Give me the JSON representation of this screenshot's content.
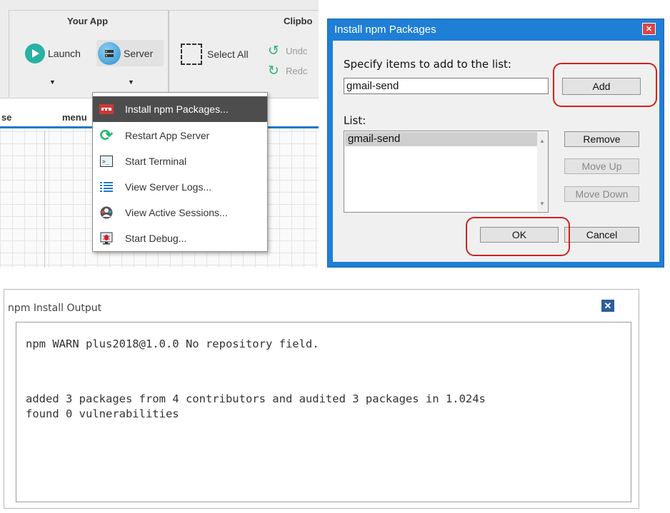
{
  "ribbon": {
    "group_your_app": "Your App",
    "launch_label": "Launch",
    "server_label": "Server",
    "group_clipboard": "Clipbo",
    "select_all_label": "Select All",
    "undo_label": "Undc",
    "redo_label": "Redc"
  },
  "tabs": {
    "left": "se",
    "menu": "menu"
  },
  "server_menu": {
    "items": [
      {
        "label": "Install npm Packages...",
        "icon": "npm-icon"
      },
      {
        "label": "Restart App Server",
        "icon": "refresh-icon"
      },
      {
        "label": "Start Terminal",
        "icon": "terminal-icon"
      },
      {
        "label": "View Server Logs...",
        "icon": "list-icon"
      },
      {
        "label": "View Active Sessions...",
        "icon": "sessions-icon"
      },
      {
        "label": "Start Debug...",
        "icon": "debug-icon"
      }
    ]
  },
  "npm_dialog": {
    "title": "Install npm Packages",
    "close_glyph": "✕",
    "specify_label": "Specify items to add to the list:",
    "input_value": "gmail-send",
    "add_button": "Add",
    "list_label": "List:",
    "list_items": [
      "gmail-send"
    ],
    "remove_button": "Remove",
    "move_up_button": "Move Up",
    "move_down_button": "Move Down",
    "ok_button": "OK",
    "cancel_button": "Cancel"
  },
  "output_window": {
    "title": "npm Install Output",
    "close_glyph": "✕",
    "lines": [
      "npm WARN plus2018@1.0.0 No repository field.",
      "added 3 packages from 4 contributors and audited 3 packages in 1.024s",
      "found 0 vulnerabilities"
    ]
  },
  "colors": {
    "accent_blue": "#1e7ac8",
    "dialog_frame": "#1f7fd6",
    "highlight_ring": "#d42020",
    "menu_active": "#4d4d4d"
  }
}
